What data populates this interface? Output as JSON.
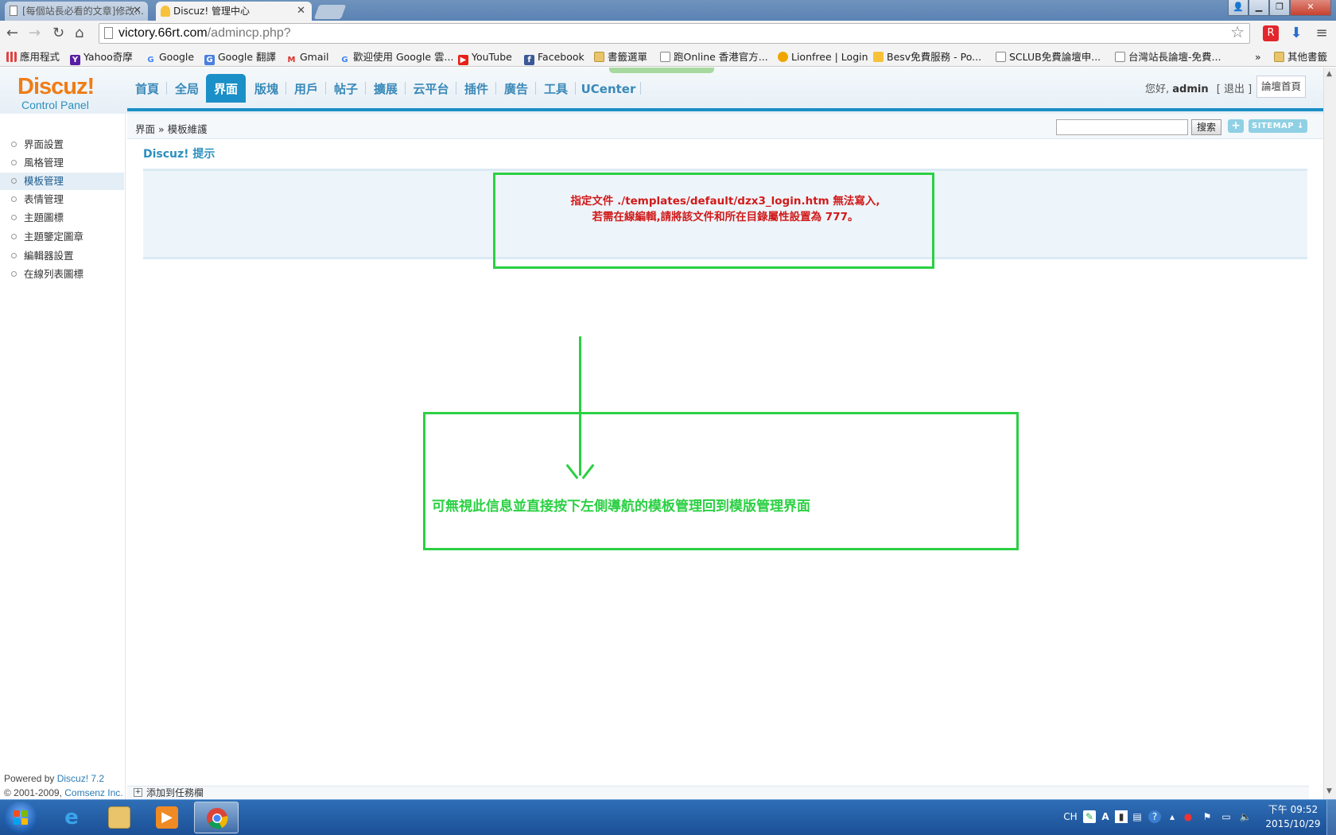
{
  "browser": {
    "tabs": [
      {
        "title": "[每個站長必看的文章]修改..."
      },
      {
        "title": "Discuz! 管理中心"
      }
    ],
    "url_domain": "victory.66rt.com",
    "url_path": "/admincp.php?",
    "bookmarks": [
      {
        "label": "應用程式",
        "icon": "apps-grid-icon"
      },
      {
        "label": "Yahoo奇摩",
        "icon": "yahoo-icon"
      },
      {
        "label": "Google",
        "icon": "google-icon"
      },
      {
        "label": "Google 翻譯",
        "icon": "google-translate-icon"
      },
      {
        "label": "Gmail",
        "icon": "gmail-icon"
      },
      {
        "label": "歡迎使用 Google 雲...",
        "icon": "google-icon"
      },
      {
        "label": "YouTube",
        "icon": "youtube-icon"
      },
      {
        "label": "Facebook",
        "icon": "facebook-icon"
      },
      {
        "label": "書籤選單",
        "icon": "folder-icon"
      },
      {
        "label": "跑Online 香港官方...",
        "icon": "page-icon"
      },
      {
        "label": "Lionfree | Login",
        "icon": "lionfree-icon"
      },
      {
        "label": "Besv免費服務 - Po...",
        "icon": "besv-icon"
      },
      {
        "label": "SCLUB免費論壇申...",
        "icon": "page-icon"
      },
      {
        "label": "台灣站長論壇-免費...",
        "icon": "page-icon"
      },
      {
        "label": "»",
        "icon": ""
      },
      {
        "label": "其他書籤",
        "icon": "folder-icon"
      }
    ]
  },
  "admin": {
    "logo_main": "Discuz!",
    "logo_sub": "Control Panel",
    "nav": [
      "首頁",
      "全局",
      "界面",
      "版塊",
      "用戶",
      "帖子",
      "擴展",
      "云平台",
      "插件",
      "廣告",
      "工具",
      "UCenter"
    ],
    "nav_active": "界面",
    "user_greeting": "您好,",
    "user_name": "admin",
    "logout": "[ 退出 ]",
    "forum_home": "論壇首頁",
    "breadcrumb": "界面 » 模板維護",
    "search_button": "搜索",
    "plus_button": "+",
    "sitemap_button": "SITEMAP ↓",
    "sidebar": [
      "界面設置",
      "風格管理",
      "模板管理",
      "表情管理",
      "主題圖標",
      "主題鑒定圖章",
      "編輯器設置",
      "在線列表圖標"
    ],
    "sidebar_active": "模板管理",
    "tip_title": "Discuz! 提示",
    "error_line1": "指定文件 ./templates/default/dzx3_login.htm 無法寫入,",
    "error_line2": "若需在線編輯,請將該文件和所在目錄屬性設置為 777。",
    "annotation": "可無視此信息並直接按下左側導航的模板管理回到模版管理界面",
    "powered_prefix": "Powered by ",
    "powered_link": "Discuz! 7.2",
    "copyright_prefix": "© 2001-2009, ",
    "copyright_link": "Comsenz Inc.",
    "bottom_add": "添加到任務欄"
  },
  "taskbar": {
    "apps": [
      "start-button",
      "internet-explorer",
      "file-explorer",
      "media-player",
      "chrome"
    ],
    "lang": "CH",
    "time": "下午 09:52",
    "date": "2015/10/29"
  },
  "colors": {
    "accent": "#1b8fc7",
    "error": "#d11a1a",
    "annotation": "#2bd043",
    "logo_orange": "#f07c16"
  }
}
